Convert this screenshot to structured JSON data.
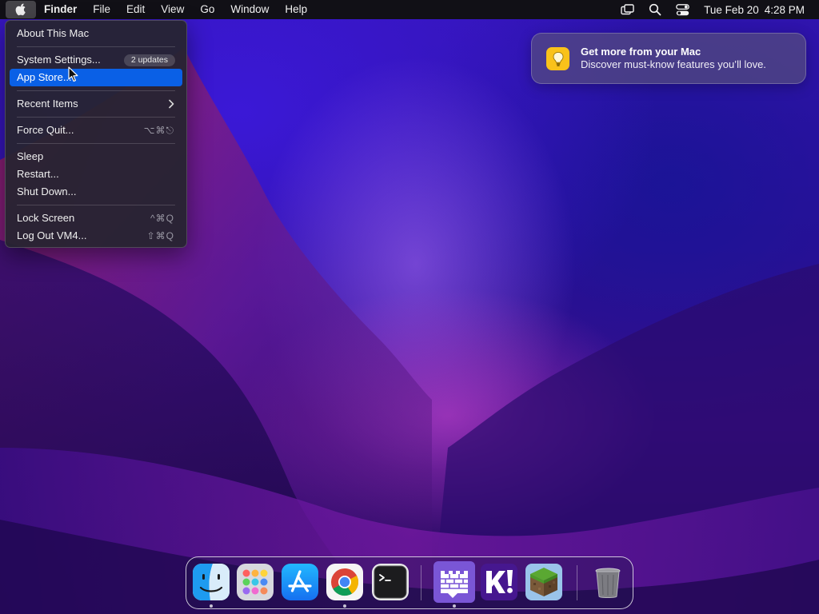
{
  "menubar": {
    "app_name": "Finder",
    "menus": [
      "File",
      "Edit",
      "View",
      "Go",
      "Window",
      "Help"
    ],
    "status_icons": [
      "screen-mirroring-icon",
      "spotlight-search-icon",
      "control-center-icon"
    ],
    "date": "Tue Feb 20",
    "time": "4:28 PM"
  },
  "apple_menu": {
    "items": [
      {
        "label": "About This Mac"
      },
      {
        "label": "System Settings...",
        "badge": "2 updates"
      },
      {
        "label": "App Store...",
        "selected": true
      },
      {
        "label": "Recent Items",
        "submenu": true
      },
      {
        "label": "Force Quit...",
        "shortcut": "⌥⌘⎋"
      },
      {
        "label": "Sleep"
      },
      {
        "label": "Restart..."
      },
      {
        "label": "Shut Down..."
      },
      {
        "label": "Lock Screen",
        "shortcut": "^⌘Q"
      },
      {
        "label": "Log Out VM4...",
        "shortcut": "⇧⌘Q"
      }
    ]
  },
  "notification": {
    "title": "Get more from your Mac",
    "body": "Discover must-know features you’ll love.",
    "icon": "lightbulb-icon"
  },
  "dock": {
    "apps": [
      {
        "name": "Finder",
        "icon": "finder-icon",
        "running": true
      },
      {
        "name": "Launchpad",
        "icon": "launchpad-icon",
        "running": false
      },
      {
        "name": "App Store",
        "icon": "app-store-icon",
        "running": false
      },
      {
        "name": "Google Chrome",
        "icon": "chrome-icon",
        "running": true
      },
      {
        "name": "Terminal",
        "icon": "terminal-icon",
        "running": false
      },
      {
        "name": "Castle app",
        "icon": "castle-icon",
        "running": true
      },
      {
        "name": "Kahoot!",
        "icon": "kahoot-icon",
        "running": false
      },
      {
        "name": "Minecraft",
        "icon": "minecraft-icon",
        "running": false
      },
      {
        "name": "Trash",
        "icon": "trash-icon",
        "running": false
      }
    ]
  },
  "colors": {
    "menu_highlight": "#0a60e6",
    "notification_icon_bg": "#f9c21a",
    "menubar_bg": "#111016"
  }
}
